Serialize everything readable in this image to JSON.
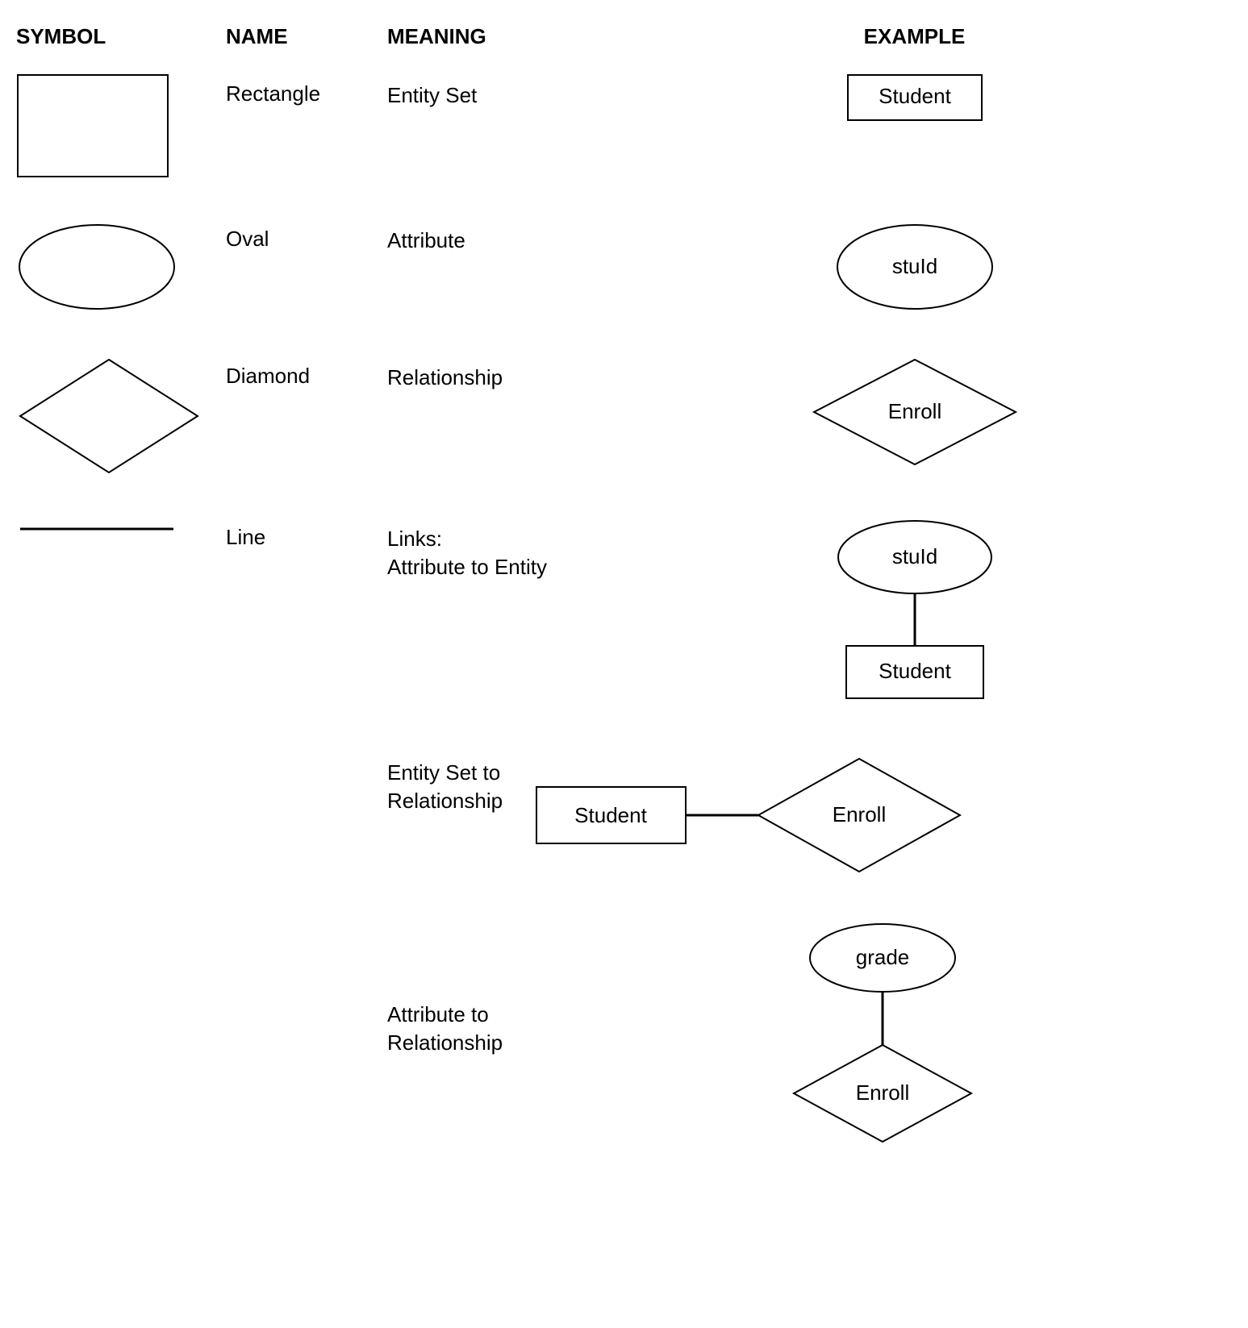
{
  "headers": {
    "symbol": "SYMBOL",
    "name": "NAME",
    "meaning": "MEANING",
    "example": "EXAMPLE"
  },
  "rows": [
    {
      "name": "Rectangle",
      "meaning": "Entity Set",
      "example_label": "Student"
    },
    {
      "name": "Oval",
      "meaning": "Attribute",
      "example_label": "stuId"
    },
    {
      "name": "Diamond",
      "meaning": "Relationship",
      "example_label": "Enroll"
    },
    {
      "name": "Line",
      "meaning": "Links:\nAttribute to Entity",
      "example_attribute": "stuId",
      "example_entity": "Student"
    },
    {
      "meaning": "Entity Set to Relationship",
      "example_entity": "Student",
      "example_relationship": "Enroll"
    },
    {
      "meaning": "Attribute to Relationship",
      "example_attribute": "grade",
      "example_relationship": "Enroll"
    }
  ]
}
